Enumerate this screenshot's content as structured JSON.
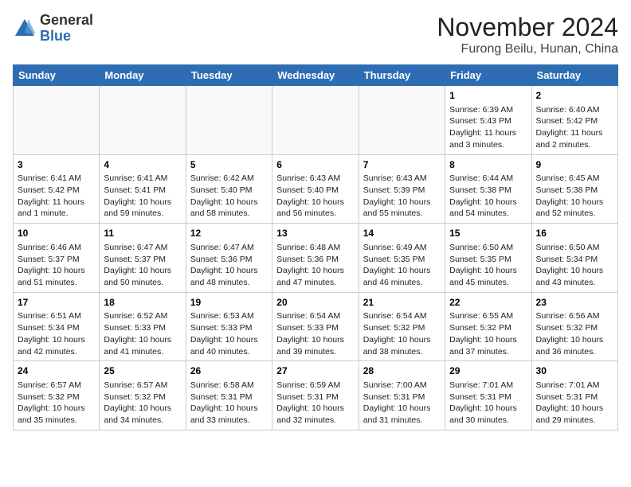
{
  "logo": {
    "general": "General",
    "blue": "Blue"
  },
  "header": {
    "month": "November 2024",
    "location": "Furong Beilu, Hunan, China"
  },
  "days_of_week": [
    "Sunday",
    "Monday",
    "Tuesday",
    "Wednesday",
    "Thursday",
    "Friday",
    "Saturday"
  ],
  "weeks": [
    [
      {
        "day": "",
        "info": ""
      },
      {
        "day": "",
        "info": ""
      },
      {
        "day": "",
        "info": ""
      },
      {
        "day": "",
        "info": ""
      },
      {
        "day": "",
        "info": ""
      },
      {
        "day": "1",
        "info": "Sunrise: 6:39 AM\nSunset: 5:43 PM\nDaylight: 11 hours and 3 minutes."
      },
      {
        "day": "2",
        "info": "Sunrise: 6:40 AM\nSunset: 5:42 PM\nDaylight: 11 hours and 2 minutes."
      }
    ],
    [
      {
        "day": "3",
        "info": "Sunrise: 6:41 AM\nSunset: 5:42 PM\nDaylight: 11 hours and 1 minute."
      },
      {
        "day": "4",
        "info": "Sunrise: 6:41 AM\nSunset: 5:41 PM\nDaylight: 10 hours and 59 minutes."
      },
      {
        "day": "5",
        "info": "Sunrise: 6:42 AM\nSunset: 5:40 PM\nDaylight: 10 hours and 58 minutes."
      },
      {
        "day": "6",
        "info": "Sunrise: 6:43 AM\nSunset: 5:40 PM\nDaylight: 10 hours and 56 minutes."
      },
      {
        "day": "7",
        "info": "Sunrise: 6:43 AM\nSunset: 5:39 PM\nDaylight: 10 hours and 55 minutes."
      },
      {
        "day": "8",
        "info": "Sunrise: 6:44 AM\nSunset: 5:38 PM\nDaylight: 10 hours and 54 minutes."
      },
      {
        "day": "9",
        "info": "Sunrise: 6:45 AM\nSunset: 5:38 PM\nDaylight: 10 hours and 52 minutes."
      }
    ],
    [
      {
        "day": "10",
        "info": "Sunrise: 6:46 AM\nSunset: 5:37 PM\nDaylight: 10 hours and 51 minutes."
      },
      {
        "day": "11",
        "info": "Sunrise: 6:47 AM\nSunset: 5:37 PM\nDaylight: 10 hours and 50 minutes."
      },
      {
        "day": "12",
        "info": "Sunrise: 6:47 AM\nSunset: 5:36 PM\nDaylight: 10 hours and 48 minutes."
      },
      {
        "day": "13",
        "info": "Sunrise: 6:48 AM\nSunset: 5:36 PM\nDaylight: 10 hours and 47 minutes."
      },
      {
        "day": "14",
        "info": "Sunrise: 6:49 AM\nSunset: 5:35 PM\nDaylight: 10 hours and 46 minutes."
      },
      {
        "day": "15",
        "info": "Sunrise: 6:50 AM\nSunset: 5:35 PM\nDaylight: 10 hours and 45 minutes."
      },
      {
        "day": "16",
        "info": "Sunrise: 6:50 AM\nSunset: 5:34 PM\nDaylight: 10 hours and 43 minutes."
      }
    ],
    [
      {
        "day": "17",
        "info": "Sunrise: 6:51 AM\nSunset: 5:34 PM\nDaylight: 10 hours and 42 minutes."
      },
      {
        "day": "18",
        "info": "Sunrise: 6:52 AM\nSunset: 5:33 PM\nDaylight: 10 hours and 41 minutes."
      },
      {
        "day": "19",
        "info": "Sunrise: 6:53 AM\nSunset: 5:33 PM\nDaylight: 10 hours and 40 minutes."
      },
      {
        "day": "20",
        "info": "Sunrise: 6:54 AM\nSunset: 5:33 PM\nDaylight: 10 hours and 39 minutes."
      },
      {
        "day": "21",
        "info": "Sunrise: 6:54 AM\nSunset: 5:32 PM\nDaylight: 10 hours and 38 minutes."
      },
      {
        "day": "22",
        "info": "Sunrise: 6:55 AM\nSunset: 5:32 PM\nDaylight: 10 hours and 37 minutes."
      },
      {
        "day": "23",
        "info": "Sunrise: 6:56 AM\nSunset: 5:32 PM\nDaylight: 10 hours and 36 minutes."
      }
    ],
    [
      {
        "day": "24",
        "info": "Sunrise: 6:57 AM\nSunset: 5:32 PM\nDaylight: 10 hours and 35 minutes."
      },
      {
        "day": "25",
        "info": "Sunrise: 6:57 AM\nSunset: 5:32 PM\nDaylight: 10 hours and 34 minutes."
      },
      {
        "day": "26",
        "info": "Sunrise: 6:58 AM\nSunset: 5:31 PM\nDaylight: 10 hours and 33 minutes."
      },
      {
        "day": "27",
        "info": "Sunrise: 6:59 AM\nSunset: 5:31 PM\nDaylight: 10 hours and 32 minutes."
      },
      {
        "day": "28",
        "info": "Sunrise: 7:00 AM\nSunset: 5:31 PM\nDaylight: 10 hours and 31 minutes."
      },
      {
        "day": "29",
        "info": "Sunrise: 7:01 AM\nSunset: 5:31 PM\nDaylight: 10 hours and 30 minutes."
      },
      {
        "day": "30",
        "info": "Sunrise: 7:01 AM\nSunset: 5:31 PM\nDaylight: 10 hours and 29 minutes."
      }
    ]
  ]
}
